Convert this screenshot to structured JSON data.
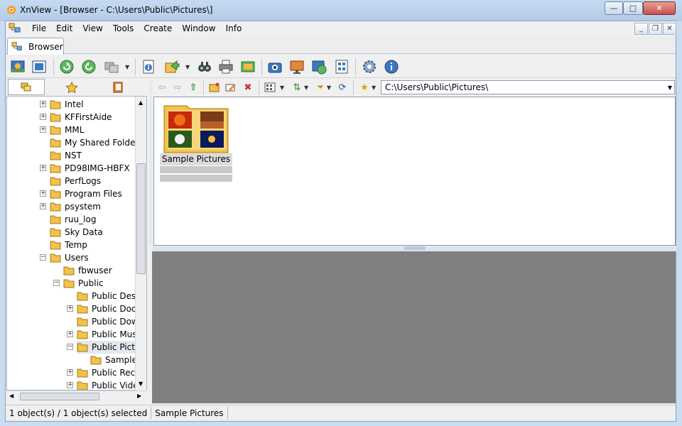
{
  "window": {
    "title": "XnView - [Browser - C:\\Users\\Public\\Pictures\\]",
    "min_label": "—",
    "max_label": "□",
    "close_label": "✕"
  },
  "menu": [
    "File",
    "Edit",
    "View",
    "Tools",
    "Create",
    "Window",
    "Info"
  ],
  "mdi": {
    "min": "_",
    "restore": "❐",
    "close": "✕"
  },
  "tab": {
    "label": "Browser"
  },
  "toolbar": {
    "buttons": [
      "fullscreen-icon",
      "fit-icon",
      "refresh-icon",
      "reload-icon",
      "convert-icon",
      "properties-icon",
      "export-icon",
      "search-icon",
      "print-icon",
      "slideshow-icon",
      "capture-icon",
      "desktop-icon",
      "web-icon",
      "multipage-icon",
      "settings-icon",
      "info-icon"
    ]
  },
  "address": {
    "path": "C:\\Users\\Public\\Pictures\\"
  },
  "tree": {
    "nodes": [
      {
        "label": "Intel",
        "exp": "+"
      },
      {
        "label": "KFFirstAide",
        "exp": "+"
      },
      {
        "label": "MML",
        "exp": "+"
      },
      {
        "label": "My Shared Folder",
        "exp": ""
      },
      {
        "label": "NST",
        "exp": ""
      },
      {
        "label": "PD98IMG-HBFX",
        "exp": "+"
      },
      {
        "label": "PerfLogs",
        "exp": ""
      },
      {
        "label": "Program Files",
        "exp": "+"
      },
      {
        "label": "psystem",
        "exp": "+"
      },
      {
        "label": "ruu_log",
        "exp": ""
      },
      {
        "label": "Sky Data",
        "exp": ""
      },
      {
        "label": "Temp",
        "exp": ""
      },
      {
        "label": "Users",
        "exp": "−"
      },
      {
        "label": "fbwuser",
        "exp": ""
      },
      {
        "label": "Public",
        "exp": "−"
      },
      {
        "label": "Public Desk",
        "exp": ""
      },
      {
        "label": "Public Doc",
        "exp": "+"
      },
      {
        "label": "Public Dow",
        "exp": ""
      },
      {
        "label": "Public Mus",
        "exp": "+"
      },
      {
        "label": "Public Pictu",
        "exp": "−"
      },
      {
        "label": "Sample",
        "exp": ""
      },
      {
        "label": "Public Reco",
        "exp": "+"
      },
      {
        "label": "Public Vide",
        "exp": "+"
      }
    ]
  },
  "files": [
    {
      "label": "Sample Pictures"
    }
  ],
  "status": {
    "count": "1 object(s) / 1 object(s) selected",
    "selected": "Sample Pictures"
  }
}
